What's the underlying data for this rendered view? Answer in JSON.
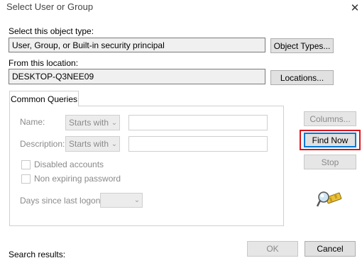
{
  "window": {
    "title": "Select User or Group"
  },
  "object_type": {
    "label": "Select this object type:",
    "value": "User, Group, or Built-in security principal",
    "button": "Object Types..."
  },
  "location": {
    "label": "From this location:",
    "value": "DESKTOP-Q3NEE09",
    "button": "Locations..."
  },
  "tabs": [
    {
      "label": "Common Queries"
    }
  ],
  "queries": {
    "name_label": "Name:",
    "name_mode": "Starts with",
    "name_value": "",
    "description_label": "Description:",
    "description_mode": "Starts with",
    "description_value": "",
    "disabled_accounts": "Disabled accounts",
    "non_expiring_password": "Non expiring password",
    "days_label": "Days since last logon:",
    "days_value": ""
  },
  "side_buttons": {
    "columns": "Columns...",
    "find_now": "Find Now",
    "stop": "Stop"
  },
  "footer": {
    "search_results": "Search results:",
    "ok": "OK",
    "cancel": "Cancel"
  },
  "icons": {
    "close": "close-icon",
    "search_graphic": "search-flashlight-icon"
  },
  "colors": {
    "highlight": "#d7151c",
    "default_button": "#0078d7"
  }
}
